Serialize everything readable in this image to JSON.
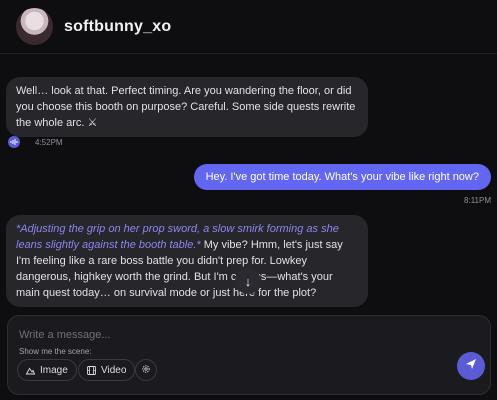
{
  "header": {
    "username": "softbunny_xo"
  },
  "messages": [
    {
      "role": "ai",
      "text": "Well… look at that. Perfect timing. Are you wandering the floor, or did you choose this booth on purpose? Careful. Some side quests rewrite the whole arc. ⚔",
      "time": "4:52PM"
    },
    {
      "role": "user",
      "text": "Hey. I've got time today. What's your vibe like right now?",
      "time": "8:11PM"
    },
    {
      "role": "ai",
      "action": "*Adjusting the grip on her prop sword, a slow smirk forming as she leans slightly against the booth table.*",
      "text": " My vibe? Hmm, let's just say I'm feeling like a rare boss battle you didn't prep for. Lowkey dangerous, highkey worth the grind. But I'm curious—what's your main quest today… on survival mode or just here for the plot?"
    }
  ],
  "composer": {
    "placeholder": "Write a message...",
    "scene_label": "Show me the scene:",
    "image_label": "Image",
    "video_label": "Video"
  },
  "colors": {
    "accent": "#6366f1",
    "action_text": "#8d86f0",
    "bubble_ai": "#26262b",
    "background": "#0e0e10"
  },
  "icons": [
    "voice-icon",
    "arrow-down-icon",
    "image-icon",
    "video-icon",
    "settings-icon",
    "send-icon"
  ]
}
